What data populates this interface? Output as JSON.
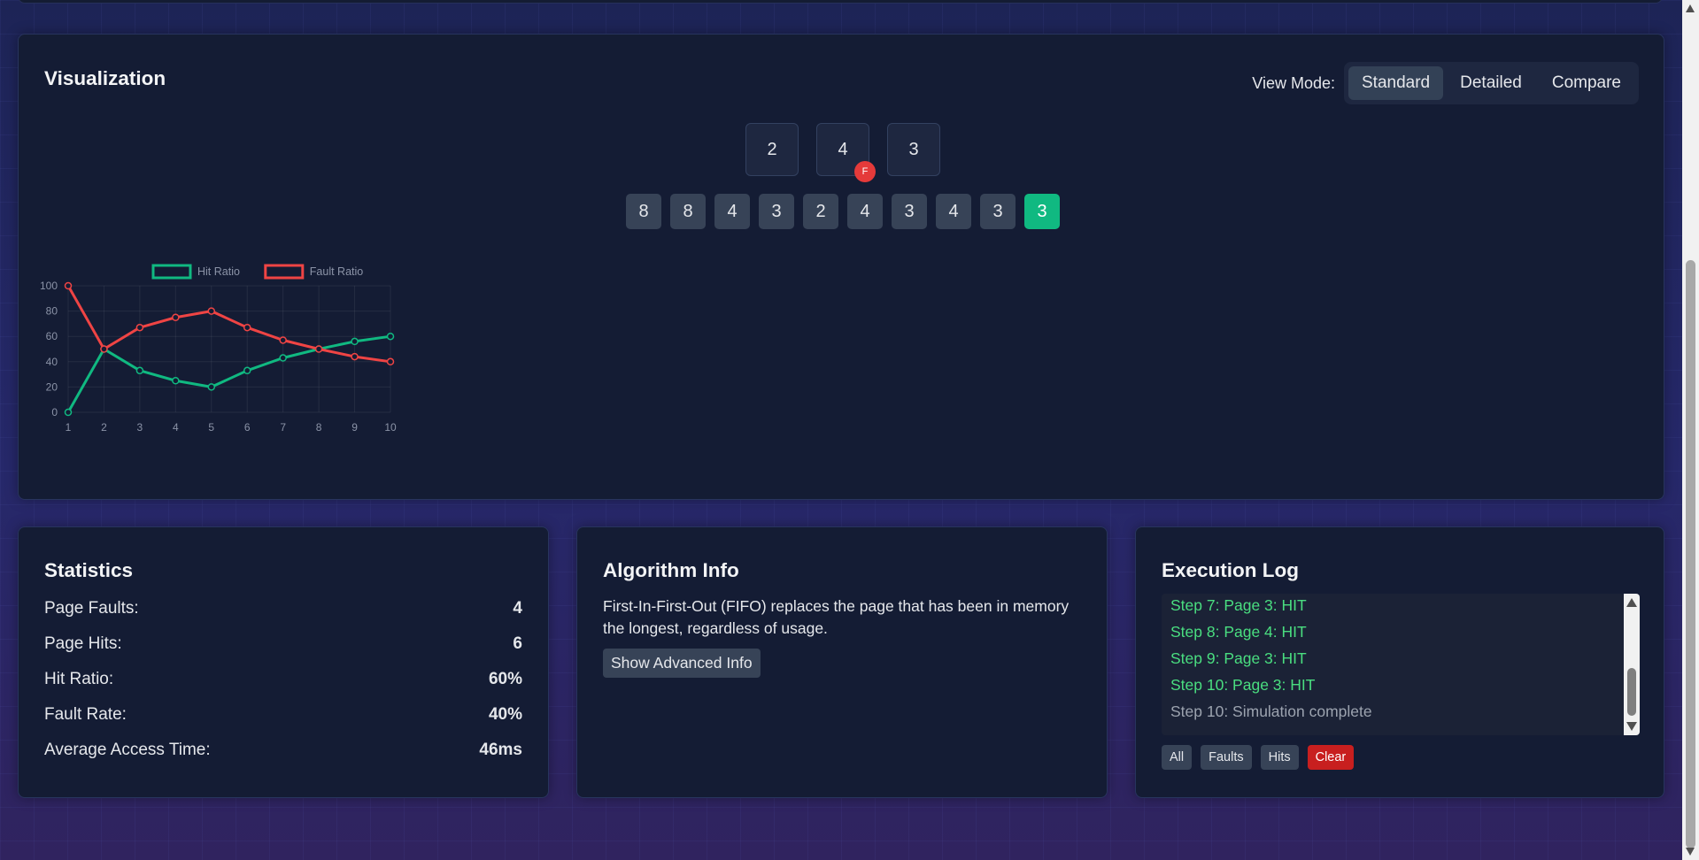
{
  "visualization": {
    "title": "Visualization",
    "view_mode_label": "View Mode:",
    "view_modes": [
      "Standard",
      "Detailed",
      "Compare"
    ],
    "active_view_mode": "Standard",
    "frames": [
      {
        "value": "2",
        "badge": ""
      },
      {
        "value": "4",
        "badge": "F"
      },
      {
        "value": "3",
        "badge": ""
      }
    ],
    "reference_sequence": [
      "8",
      "8",
      "4",
      "3",
      "2",
      "4",
      "3",
      "4",
      "3",
      "3"
    ],
    "current_index": 9
  },
  "chart_data": {
    "type": "line",
    "x": [
      1,
      2,
      3,
      4,
      5,
      6,
      7,
      8,
      9,
      10
    ],
    "series": [
      {
        "name": "Hit Ratio",
        "color": "#10b981",
        "values": [
          0,
          50,
          33,
          25,
          20,
          33,
          43,
          50,
          56,
          60
        ]
      },
      {
        "name": "Fault Ratio",
        "color": "#ef4444",
        "values": [
          100,
          50,
          67,
          75,
          80,
          67,
          57,
          50,
          44,
          40
        ]
      }
    ],
    "ylim": [
      0,
      100
    ],
    "yticks": [
      0,
      20,
      40,
      60,
      80,
      100
    ],
    "grid": true,
    "legend": "top"
  },
  "statistics": {
    "title": "Statistics",
    "rows": [
      {
        "label": "Page Faults:",
        "value": "4"
      },
      {
        "label": "Page Hits:",
        "value": "6"
      },
      {
        "label": "Hit Ratio:",
        "value": "60%"
      },
      {
        "label": "Fault Rate:",
        "value": "40%"
      },
      {
        "label": "Average Access Time:",
        "value": "46ms"
      }
    ]
  },
  "algorithm": {
    "title": "Algorithm Info",
    "description": "First-In-First-Out (FIFO) replaces the page that has been in memory the longest, regardless of usage.",
    "advanced_button": "Show Advanced Info"
  },
  "log": {
    "title": "Execution Log",
    "entries": [
      {
        "text": "Step 7: Page 3: HIT",
        "type": "hit"
      },
      {
        "text": "Step 8: Page 4: HIT",
        "type": "hit"
      },
      {
        "text": "Step 9: Page 3: HIT",
        "type": "hit"
      },
      {
        "text": "Step 10: Page 3: HIT",
        "type": "hit"
      },
      {
        "text": "Step 10: Simulation complete",
        "type": "info"
      }
    ],
    "filters": [
      "All",
      "Faults",
      "Hits",
      "Clear"
    ]
  }
}
